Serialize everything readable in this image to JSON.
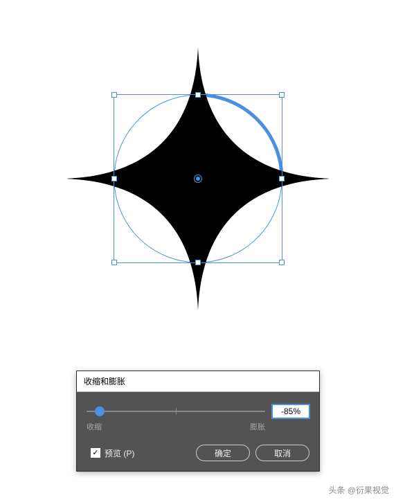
{
  "dialog": {
    "title": "收缩和膨胀",
    "shrink_label": "收缩",
    "expand_label": "膨胀",
    "value": "-85%",
    "slider_percent": 7.5,
    "preview_checked": true,
    "preview_label": "预览 (P)",
    "ok_label": "确定",
    "cancel_label": "取消"
  },
  "watermark": "头条 @衍果视觉",
  "colors": {
    "accent": "#4a90e2",
    "dialog_bg": "#535353"
  }
}
